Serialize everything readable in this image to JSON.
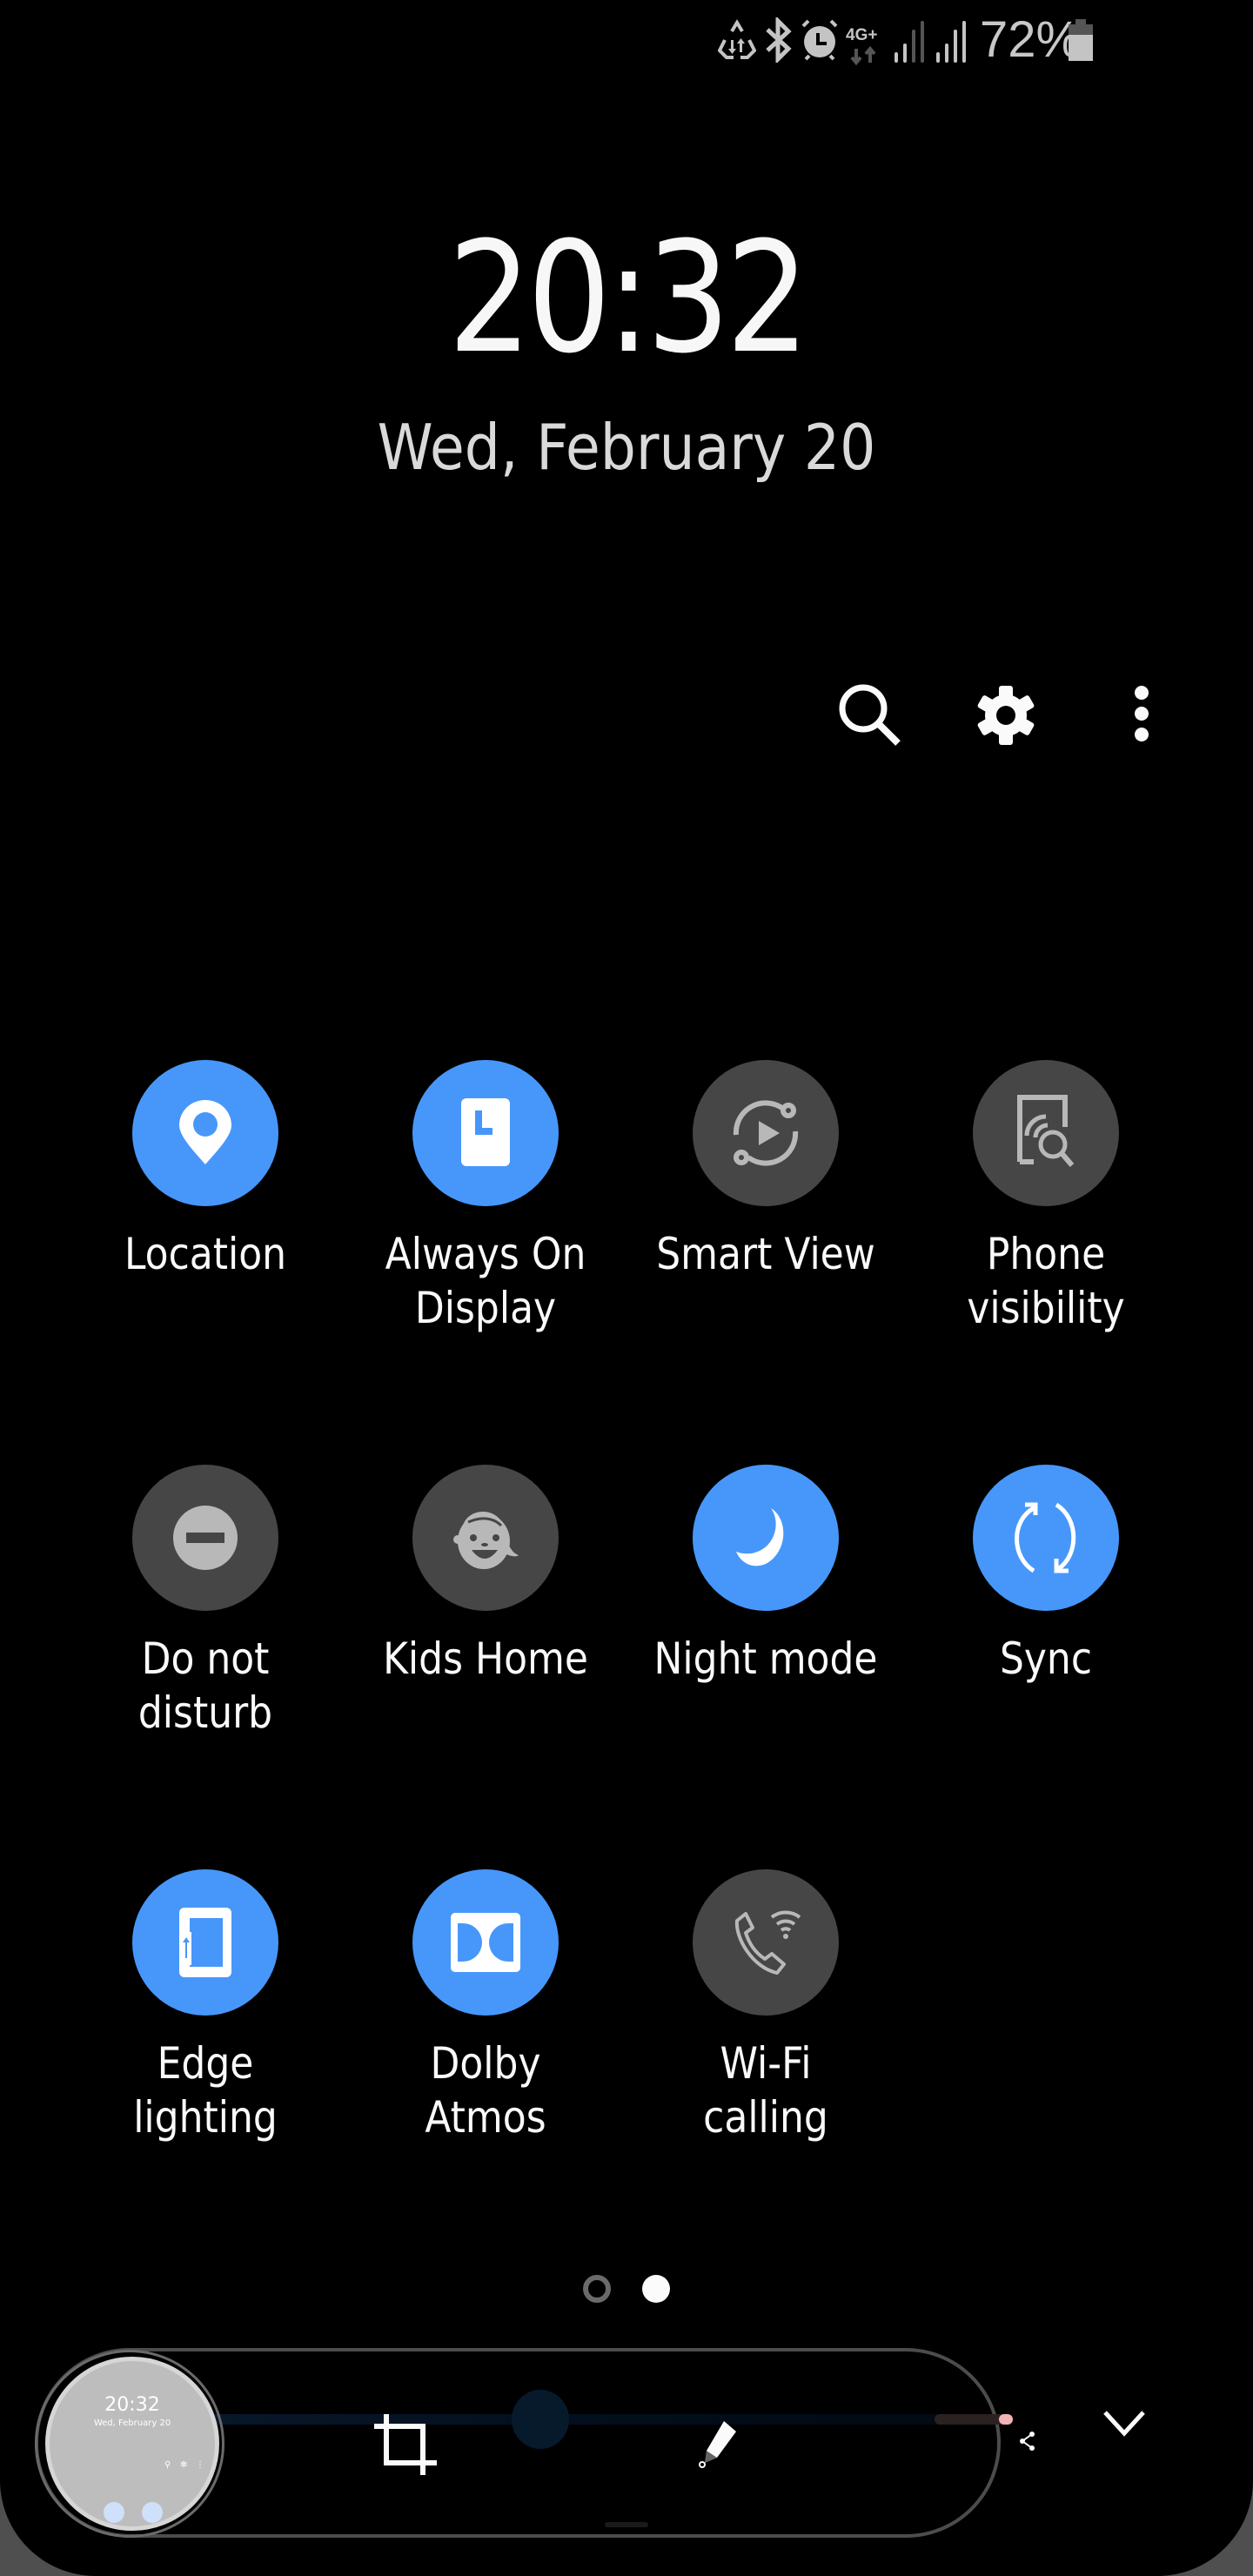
{
  "status_bar": {
    "icons": [
      "data-saver-icon",
      "bluetooth-icon",
      "alarm-icon",
      "network-4g-plus-icon",
      "signal-sim1-icon",
      "signal-sim2-icon",
      "battery-icon"
    ],
    "network_type": "4G+",
    "battery_percent": "72%"
  },
  "lock": {
    "time": "20:32",
    "date": "Wed, February 20"
  },
  "top_actions": [
    {
      "name": "search",
      "icon": "search-icon"
    },
    {
      "name": "settings",
      "icon": "gear-icon"
    },
    {
      "name": "more-options",
      "icon": "more-vertical-icon"
    }
  ],
  "tiles": [
    {
      "label": "Location",
      "icon": "location-pin-icon",
      "state": "on"
    },
    {
      "label": "Always On\nDisplay",
      "icon": "always-on-display-icon",
      "state": "on"
    },
    {
      "label": "Smart View",
      "icon": "smart-view-icon",
      "state": "off"
    },
    {
      "label": "Phone\nvisibility",
      "icon": "phone-visibility-icon",
      "state": "off"
    },
    {
      "label": "Do not\ndisturb",
      "icon": "do-not-disturb-icon",
      "state": "off"
    },
    {
      "label": "Kids Home",
      "icon": "kids-home-icon",
      "state": "off"
    },
    {
      "label": "Night mode",
      "icon": "moon-icon",
      "state": "on"
    },
    {
      "label": "Sync",
      "icon": "sync-icon",
      "state": "on"
    },
    {
      "label": "Edge\nlighting",
      "icon": "edge-lighting-icon",
      "state": "on"
    },
    {
      "label": "Dolby\nAtmos",
      "icon": "dolby-icon",
      "state": "on"
    },
    {
      "label": "Wi-Fi\ncalling",
      "icon": "wifi-calling-icon",
      "state": "off"
    }
  ],
  "page_indicator": {
    "current": 2,
    "total": 2
  },
  "screenshot_toolbar": {
    "thumbnail": {
      "time": "20:32",
      "date": "Wed, February 20"
    },
    "buttons": [
      "crop-icon",
      "draw-icon",
      "share-icon",
      "collapse-chevron-icon"
    ]
  },
  "colors": {
    "accent_on": "#4797fb",
    "tile_off": "#464646",
    "background": "#000000"
  }
}
